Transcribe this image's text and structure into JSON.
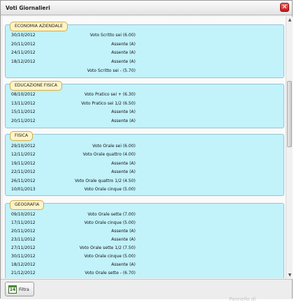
{
  "window": {
    "title": "Voti Giornalieri",
    "close_icon": "close-icon"
  },
  "subjects": [
    {
      "name": "ECONOMIA AZIENDALE",
      "rows": [
        {
          "date": "30/10/2012",
          "grade": "Voto Scritto sei (6.00)"
        },
        {
          "date": "20/11/2012",
          "grade": "Assente (A)"
        },
        {
          "date": "24/11/2012",
          "grade": "Assente (A)"
        },
        {
          "date": "18/12/2012",
          "grade": "Assente (A)"
        },
        {
          "date": "",
          "grade": "Voto Scritto sei - (5.70)"
        }
      ]
    },
    {
      "name": "EDUCAZIONE FISICA",
      "rows": [
        {
          "date": "08/10/2012",
          "grade": "Voto Pratico sei + (6.30)"
        },
        {
          "date": "13/11/2012",
          "grade": "Voto Pratico sei 1/2 (6.50)"
        },
        {
          "date": "15/11/2012",
          "grade": "Assente (A)"
        },
        {
          "date": "20/11/2012",
          "grade": "Assente (A)"
        }
      ]
    },
    {
      "name": "FISICA",
      "rows": [
        {
          "date": "29/10/2012",
          "grade": "Voto Orale sei (6.00)"
        },
        {
          "date": "12/11/2012",
          "grade": "Voto Orale quattro (4.00)"
        },
        {
          "date": "19/11/2012",
          "grade": "Assente (A)"
        },
        {
          "date": "22/11/2012",
          "grade": "Assente (A)"
        },
        {
          "date": "26/11/2012",
          "grade": "Voto Orale quattro 1/2 (4.50)"
        },
        {
          "date": "10/01/2013",
          "grade": "Voto Orale cinque (5.00)"
        }
      ]
    },
    {
      "name": "GEOGRAFIA",
      "rows": [
        {
          "date": "09/10/2012",
          "grade": "Voto Orale sette (7.00)"
        },
        {
          "date": "17/11/2012",
          "grade": "Voto Orale cinque (5.00)"
        },
        {
          "date": "20/11/2012",
          "grade": "Assente (A)"
        },
        {
          "date": "23/11/2012",
          "grade": "Assente (A)"
        },
        {
          "date": "27/11/2012",
          "grade": "Voto Orale sette 1/2 (7.50)"
        },
        {
          "date": "30/11/2012",
          "grade": "Voto Orale cinque (5.00)"
        },
        {
          "date": "18/12/2012",
          "grade": "Assente (A)"
        },
        {
          "date": "21/12/2012",
          "grade": "Voto Orale sette - (6.70)"
        }
      ]
    }
  ],
  "footer": {
    "filter_label": "Filtra",
    "calendar_day": "14"
  },
  "background_text": "Pannello di"
}
